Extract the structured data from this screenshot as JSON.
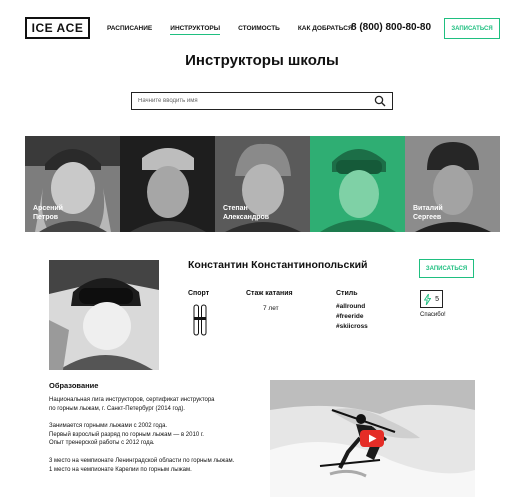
{
  "header": {
    "logo": "ICE ACE",
    "nav": [
      "РАСПИСАНИЕ",
      "ИНСТРУКТОРЫ",
      "СТОИМОСТЬ",
      "КАК ДОБРАТЬСЯ"
    ],
    "active_nav": "ИНСТРУКТОРЫ",
    "phone": "8 (800) 800-80-80",
    "signup_label": "ЗАПИСАТЬСЯ"
  },
  "page_title": "Инструкторы школы",
  "search": {
    "placeholder": "Начните вводить имя",
    "value": ""
  },
  "instructors": [
    {
      "first": "Арсений",
      "last": "Петров",
      "highlighted": false
    },
    {
      "first": "",
      "last": "",
      "highlighted": false
    },
    {
      "first": "Степан",
      "last": "Александров",
      "highlighted": false
    },
    {
      "first": "",
      "last": "",
      "highlighted": true
    },
    {
      "first": "Виталий",
      "last": "Сергеев",
      "highlighted": false
    }
  ],
  "profile": {
    "name": "Константин Константинопольский",
    "signup_label": "ЗАПИСАТЬСЯ",
    "sport_label": "Спорт",
    "sport_icon": "skis-icon",
    "experience_label": "Стаж катания",
    "experience_value": "7 лет",
    "style_label": "Стиль",
    "tags": [
      "#allround",
      "#freeride",
      "#skiicross"
    ],
    "likes": "5",
    "thanks_label": "Спасибо!",
    "education_title": "Образование",
    "education": [
      "Национальная лига инструкторов, сертификат инструктора",
      "по горным лыжам, г. Санкт-Петербург (2014 год).",
      "Занимается горными лыжами с 2002 года.",
      "Первый взрослый разряд по горным лыжам — в 2010 г.",
      "Опыт тренерской работы с 2012 года.",
      "3 место на чемпионате Ленинградской области по горным лыжам.",
      "1 место на чемпионате Карелии по горным лыжам."
    ]
  },
  "colors": {
    "accent": "#1fbf80",
    "text": "#111111"
  }
}
